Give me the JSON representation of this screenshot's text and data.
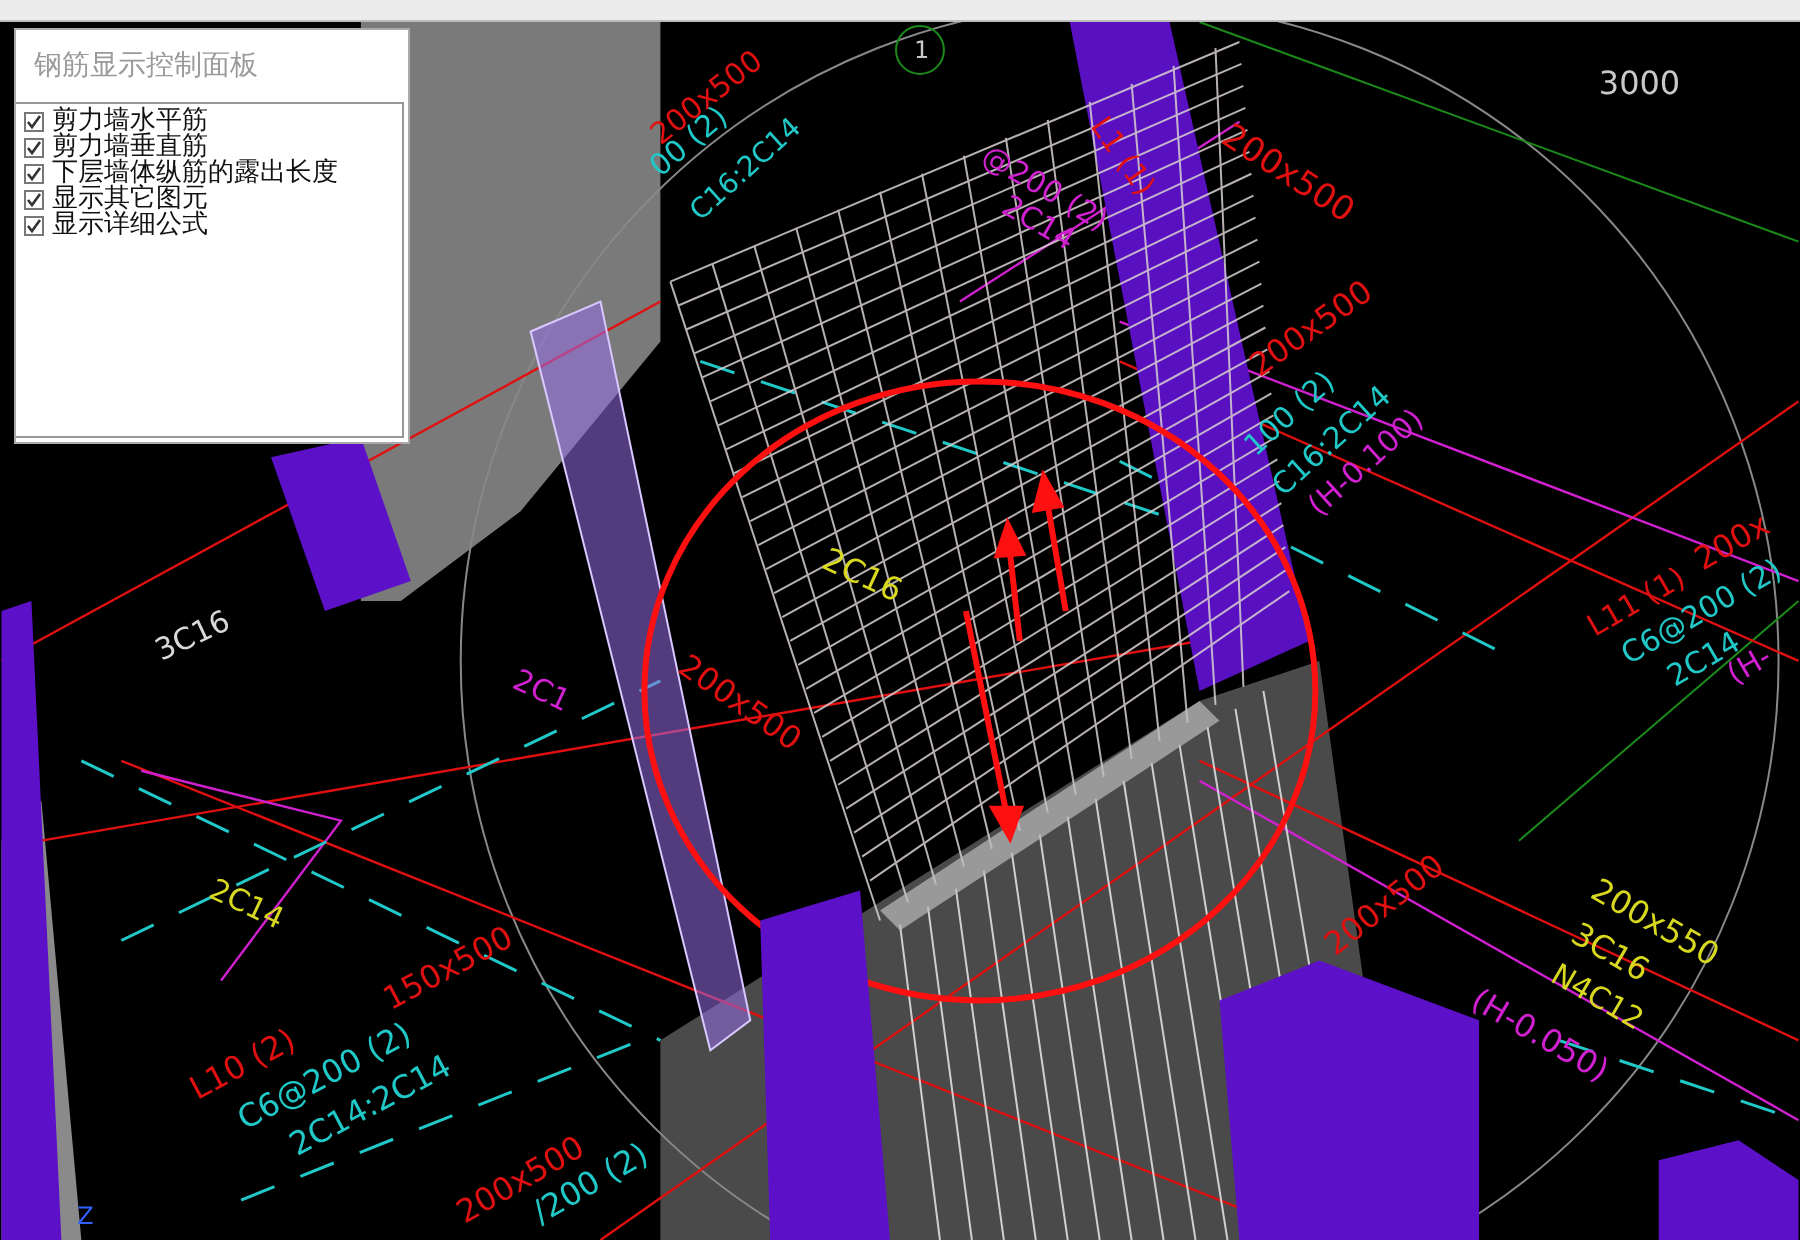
{
  "panel": {
    "title": "钢筋显示控制面板",
    "options": [
      {
        "label": "剪力墙水平筋",
        "checked": true
      },
      {
        "label": "剪力墙垂直筋",
        "checked": true
      },
      {
        "label": "下层墙体纵筋的露出长度",
        "checked": true
      },
      {
        "label": "显示其它图元",
        "checked": true
      },
      {
        "label": "显示详细公式",
        "checked": true
      }
    ]
  },
  "scene": {
    "labels": [
      {
        "text": "3000",
        "color": "#c8c8c8"
      },
      {
        "text": "1",
        "color": "#c8c8c8"
      },
      {
        "text": "L1 (1)",
        "color": "#e01010"
      },
      {
        "text": "200x500",
        "color": "#e01010"
      },
      {
        "text": "@200 (2)",
        "color": "#d020d0"
      },
      {
        "text": "2C14",
        "color": "#d020d0"
      },
      {
        "text": "200x500",
        "color": "#e01010"
      },
      {
        "text": "00 (2)",
        "color": "#20c8c8"
      },
      {
        "text": "C16:2C14",
        "color": "#20c8c8"
      },
      {
        "text": "200x500",
        "color": "#e01010"
      },
      {
        "text": "100 (2)",
        "color": "#20c8c8"
      },
      {
        "text": "C16:2C14",
        "color": "#20c8c8"
      },
      {
        "text": "(H-0.100)",
        "color": "#d020d0"
      },
      {
        "text": "200x",
        "color": "#e01010"
      },
      {
        "text": "L11 (1)",
        "color": "#e01010"
      },
      {
        "text": "C6@200 (2)",
        "color": "#20c8c8"
      },
      {
        "text": "2C14",
        "color": "#20c8c8"
      },
      {
        "text": "(H-",
        "color": "#d020d0"
      },
      {
        "text": "3C16",
        "color": "#d8d8d8"
      },
      {
        "text": "2C16",
        "color": "#d8d820"
      },
      {
        "text": "2C1",
        "color": "#d020d0"
      },
      {
        "text": "200x500",
        "color": "#e01010"
      },
      {
        "text": "2C14",
        "color": "#d8d820"
      },
      {
        "text": "150x500",
        "color": "#e01010"
      },
      {
        "text": "L10 (2)",
        "color": "#e01010"
      },
      {
        "text": "C6@200 (2)",
        "color": "#20c8c8"
      },
      {
        "text": "2C14:2C14",
        "color": "#20c8c8"
      },
      {
        "text": "200x500",
        "color": "#e01010"
      },
      {
        "text": "/200 (2)",
        "color": "#20c8c8"
      },
      {
        "text": "200x500",
        "color": "#e01010"
      },
      {
        "text": "200x550",
        "color": "#d8d820"
      },
      {
        "text": "3C16",
        "color": "#d8d820"
      },
      {
        "text": "N4C12",
        "color": "#d8d820"
      },
      {
        "text": "(H-0.050)",
        "color": "#d020d0"
      },
      {
        "text": "Z",
        "color": "#3060ff"
      }
    ]
  }
}
